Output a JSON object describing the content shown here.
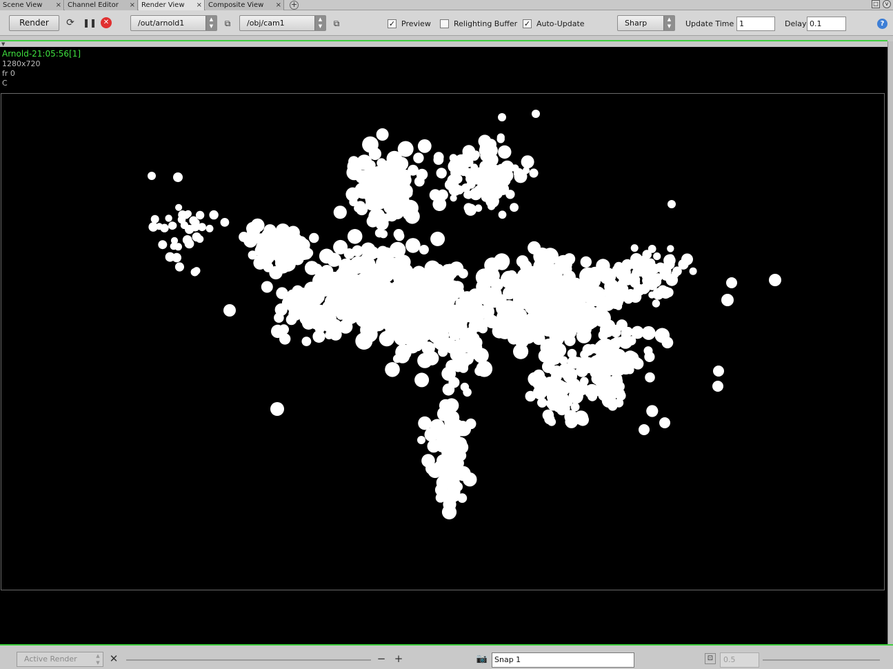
{
  "tabs": [
    {
      "label": "Scene View",
      "active": false
    },
    {
      "label": "Channel Editor",
      "active": false
    },
    {
      "label": "Render View",
      "active": true
    },
    {
      "label": "Composite View",
      "active": false
    }
  ],
  "toolbar": {
    "render_label": "Render",
    "output_driver": "/out/arnold1",
    "camera": "/obj/cam1",
    "preview_label": "Preview",
    "preview_checked": true,
    "relighting_label": "Relighting Buffer",
    "relighting_checked": false,
    "autoupdate_label": "Auto-Update",
    "autoupdate_checked": true,
    "filter_mode": "Sharp",
    "update_time_label": "Update Time",
    "update_time_value": "1",
    "delay_label": "Delay",
    "delay_value": "0.1"
  },
  "viewport": {
    "title": "Arnold-21:05:56[1]",
    "resolution": "1280x720",
    "frame": "fr 0",
    "channel": "C"
  },
  "statusbar": {
    "active_render_label": "Active Render",
    "snap_value": "Snap  1",
    "zoom_value": "0.5"
  },
  "colors": {
    "accent_green": "#3fcf3f",
    "render_background": "#000000",
    "render_particles": "#ffffff"
  }
}
